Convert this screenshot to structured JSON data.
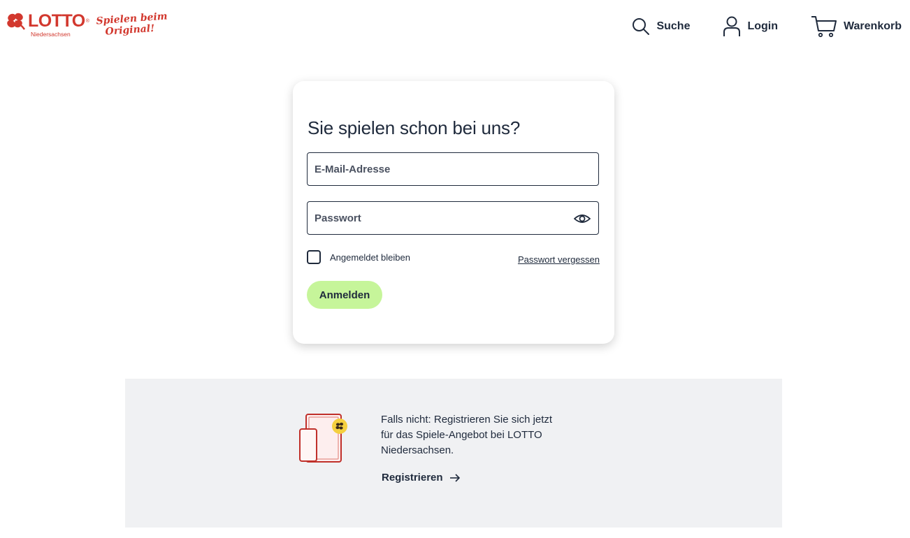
{
  "brand": {
    "name": "LOTTO",
    "registered": "®",
    "region": "Niedersachsen",
    "slogan_line1": "Spielen beim",
    "slogan_line2": "Original!",
    "color": "#d2382e"
  },
  "nav": {
    "search_label": "Suche",
    "login_label": "Login",
    "cart_label": "Warenkorb",
    "icons": [
      "search-icon",
      "user-icon",
      "cart-icon"
    ]
  },
  "login": {
    "title": "Sie spielen schon bei uns?",
    "email_placeholder": "E-Mail-Adresse",
    "password_placeholder": "Passwort",
    "remember_label": "Angemeldet bleiben",
    "forgot_label": "Passwort vergessen",
    "submit_label": "Anmelden",
    "submit_color": "#c6f59a"
  },
  "register": {
    "text": "Falls nicht: Registrieren Sie sich jetzt für das Spiele-Angebot bei LOTTO Niedersachsen.",
    "link_label": "Registrieren",
    "band_color": "#f0f1f3"
  }
}
